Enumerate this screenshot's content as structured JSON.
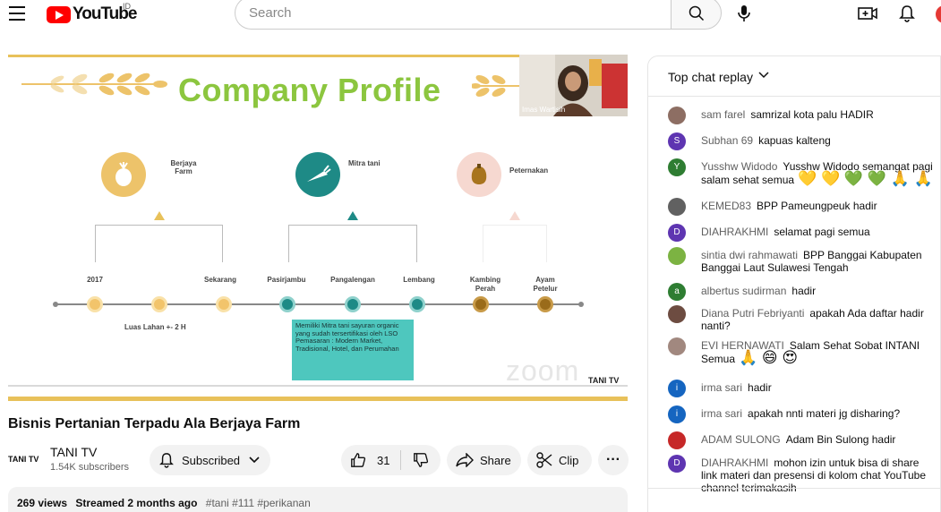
{
  "header": {
    "logo_text": "YouTube",
    "country": "ID",
    "search_placeholder": "Search"
  },
  "video": {
    "slide_title": "Company Profile",
    "cam_name": "Imas Wartisih",
    "circles": [
      {
        "label": "Berjaya Farm"
      },
      {
        "label": "Mitra tani"
      },
      {
        "label": "Peternakan"
      }
    ],
    "timeline": [
      "2017",
      "Sekarang",
      "Pasirjambu",
      "Pangalengan",
      "Lembang",
      "Kambing Perah",
      "Ayam Petelur"
    ],
    "note_left": "Luas Lahan +- 2 H",
    "note_box": "Memiliki Mitra tani sayuran organic yang sudah tersertifikasi oleh LSO Pemasaran : Modern Market, Tradisional, Hotel, dan Perumahan",
    "zoom_mark": "zoom",
    "badge": "TANI TV"
  },
  "title": "Bisnis Pertanian Terpadu Ala Berjaya Farm",
  "channel": {
    "logo": "TANI TV",
    "name": "TANI TV",
    "subs": "1.54K subscribers",
    "subscribe_label": "Subscribed"
  },
  "actions": {
    "likes": "31",
    "share": "Share",
    "clip": "Clip",
    "more": "···"
  },
  "description": {
    "views": "269 views",
    "streamed": "Streamed 2 months ago",
    "tags": "#tani #111 #perikanan"
  },
  "chat": {
    "header": "Top chat replay",
    "messages": [
      {
        "author": "sam farel",
        "text": "samrizal kota palu HADIR",
        "initial": "",
        "color": "#8d6e63"
      },
      {
        "author": "Subhan 69",
        "text": "kapuas kalteng",
        "initial": "S",
        "color": "#5e35b1"
      },
      {
        "author": "Yusshw Widodo",
        "text": "Yusshw Widodo semangat pagi salam sehat semua",
        "emoji": "💛 💛 💚 💚 🙏 🙏",
        "initial": "Y",
        "color": "#2e7d32"
      },
      {
        "author": "KEMED83",
        "text": "BPP Pameungpeuk hadir",
        "initial": "",
        "color": "#616161"
      },
      {
        "author": "DIAHRAKHMI",
        "text": "selamat pagi semua",
        "initial": "D",
        "color": "#5e35b1"
      },
      {
        "author": "sintia dwi rahmawati",
        "text": "BPP Banggai Kabupaten Banggai Laut Sulawesi Tengah",
        "initial": "",
        "color": "#7cb342"
      },
      {
        "author": "albertus sudirman",
        "text": "hadir",
        "initial": "a",
        "color": "#2e7d32"
      },
      {
        "author": "Diana Putri Febriyanti",
        "text": "apakah Ada daftar hadir nanti?",
        "initial": "",
        "color": "#6d4c41"
      },
      {
        "author": "EVI HERNAWATI",
        "text": "Salam Sehat Sobat INTANI Semua",
        "emoji": "🙏 😄 😍",
        "initial": "",
        "color": "#a1887f"
      },
      {
        "author": "irma sari",
        "text": "hadir",
        "initial": "i",
        "color": "#1565c0"
      },
      {
        "author": "irma sari",
        "text": "apakah nnti materi jg disharing?",
        "initial": "i",
        "color": "#1565c0"
      },
      {
        "author": "ADAM SULONG",
        "text": "Adam Bin Sulong hadir",
        "initial": "",
        "color": "#c62828"
      },
      {
        "author": "DIAHRAKHMI",
        "text": "mohon izin untuk bisa di share link materi dan presensi di kolom chat YouTube channel terimakasih",
        "initial": "D",
        "color": "#5e35b1"
      }
    ]
  }
}
